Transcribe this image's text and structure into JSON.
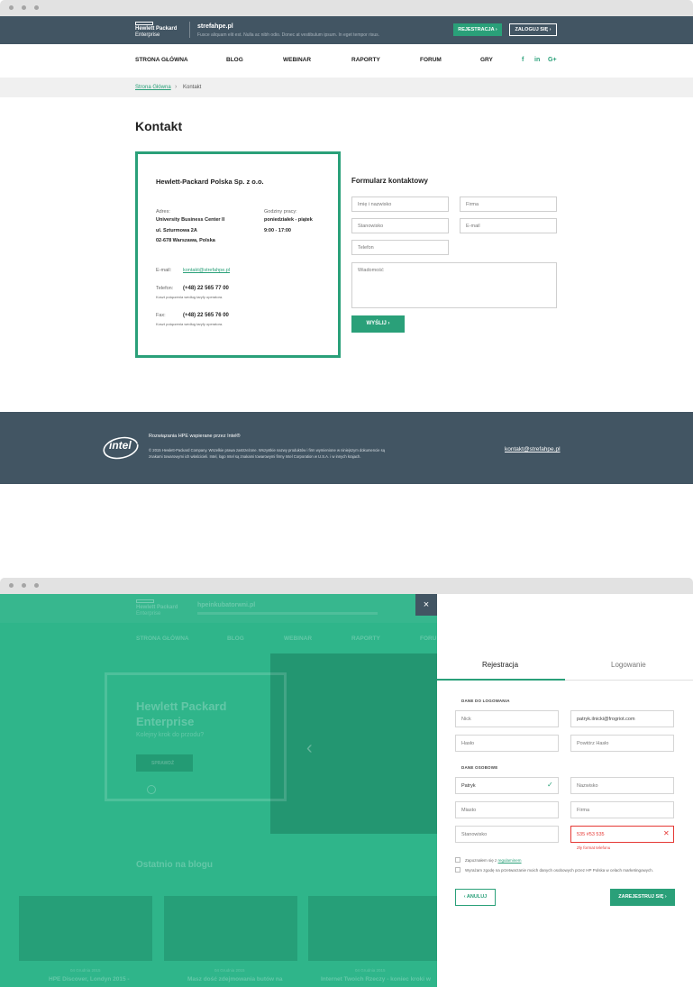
{
  "header": {
    "logo_line1": "Hewlett Packard",
    "logo_line2": "Enterprise",
    "site_name": "strefahpe.pl",
    "site_desc": "Fusce aliquam elit est. Nulla ac nibh odio. Donec at vestibulum ipsum. In eget tempor risus.",
    "register_label": "REJESTRACJA",
    "login_label": "ZALOGUJ SIĘ"
  },
  "nav": {
    "items": [
      "STRONA GŁÓWNA",
      "BLOG",
      "WEBINAR",
      "RAPORTY",
      "FORUM",
      "GRY"
    ],
    "social": [
      "f",
      "in",
      "G+"
    ]
  },
  "breadcrumb": {
    "home": "Strona Główna",
    "separator": "›",
    "current": "Kontakt"
  },
  "page_title": "Kontakt",
  "contact_card": {
    "company": "Hewlett-Packard Polska Sp. z o.o.",
    "address_label": "Adres:",
    "address_lines": [
      "University Business Center II",
      "ul. Szturmowa 2A",
      "02-678 Warszawa, Polska"
    ],
    "hours_label": "Godziny pracy:",
    "hours_lines": [
      "poniedziałek - piątek",
      "9:00 - 17:00"
    ],
    "email_label": "E-mail:",
    "email": "kontakt@strefahpe.pl",
    "phone_label": "Telefon:",
    "phone": "(+48) 22 565 77 00",
    "phone_note": "Koszt połączenia według taryfy operatora.",
    "fax_label": "Fax:",
    "fax": "(+48) 22 565 76 00",
    "fax_note": "Koszt połączenia według taryfy operatora."
  },
  "contact_form": {
    "title": "Formularz kontaktowy",
    "name_placeholder": "Imię i nazwisko",
    "company_placeholder": "Firma",
    "position_placeholder": "Stanowisko",
    "email_placeholder": "E-mail",
    "phone_placeholder": "Telefon",
    "message_placeholder": "Wiadomość",
    "send_label": "WYŚLIJ"
  },
  "footer": {
    "intel_logo": "intel",
    "tagline": "Rozwiązania HPE wspierane przez Intel®",
    "copyright_line1": "© 2015 Hewlett-Packard Company. Wszelkie prawa zastrzeżone. Wszystkie nazwy produktów i firm wymienione w niniejszym dokumencie są",
    "copyright_line2": "znakami towarowymi ich właścicieli. Intel, logo Intel są znakami towarowymi firmy Intel Corporation w U.S.A. i w innych krajach.",
    "email": "kontakt@strefahpe.pl"
  },
  "overlay_bg": {
    "logo_line1": "Hewlett Packard",
    "logo_line2": "Enterprise",
    "site_name": "hpeinkubatorwni.pl",
    "nav": [
      "STRONA GŁÓWNA",
      "BLOG",
      "WEBINAR",
      "RAPORTY",
      "FORU"
    ],
    "hero_title_1": "Hewlett Packard",
    "hero_title_2": "Enterprise",
    "hero_sub": "Kolejny krok do przodu?",
    "hero_btn": "SPRAWDŹ",
    "blog_title": "Ostatnio na blogu",
    "posts": [
      {
        "date": "04 Grudnia 2015",
        "title": "HPE Discover, Londyn 2015 -"
      },
      {
        "date": "04 Grudnia 2015",
        "title": "Masz dość zdejmowania butów na"
      },
      {
        "date": "04 Grudnia 2015",
        "title": "Internet Twoich Rzeczy - koniec kroki w"
      }
    ]
  },
  "modal": {
    "close_label": "×",
    "tab_register": "Rejestracja",
    "tab_login": "Logowanie",
    "login_section": "DANE DO LOGOWANIA",
    "nick_placeholder": "Nick",
    "email_value": "patryk.ilnicki@frogriot.com",
    "password_placeholder": "Hasło",
    "password_repeat_placeholder": "Powtórz Hasło",
    "personal_section": "DANE OSOBOWE",
    "first_name_value": "Patryk",
    "last_name_placeholder": "Nazwisko",
    "city_placeholder": "Miasto",
    "company_placeholder": "Firma",
    "position_placeholder": "Stanowisko",
    "phone_value": "535 #53 535",
    "phone_error": "Zły format telefonu",
    "terms_text": "Zapoznałem się z",
    "terms_link": "regulaminem",
    "consent_text": "Wyrażam zgodę na przetwarzanie moich danych osobowych przez HP Polska w celach marketingowych.",
    "cancel_label": "ANULUJ",
    "submit_label": "ZAREJESTRUJ SIĘ"
  },
  "colors": {
    "accent": "#2aa079",
    "dark": "#425563",
    "overlay": "#2fb58a",
    "error": "#e53935"
  }
}
